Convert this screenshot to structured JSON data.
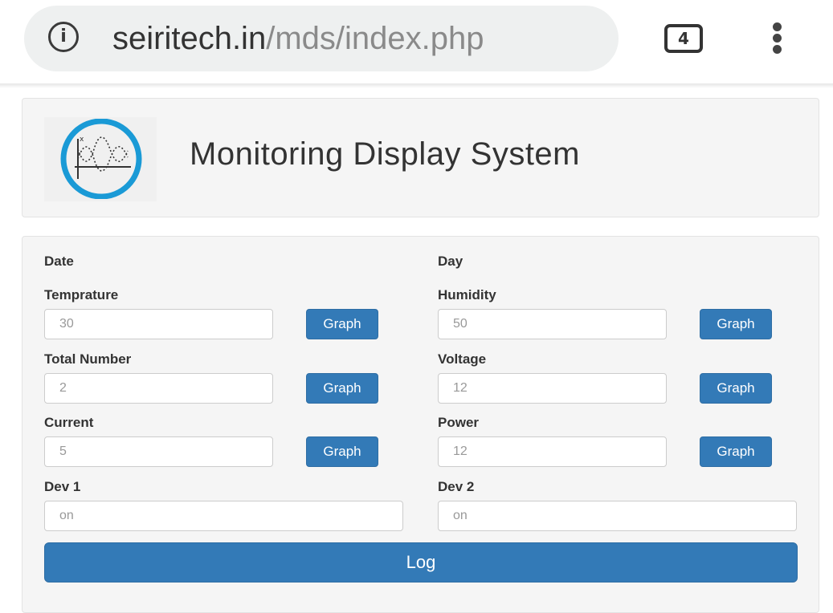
{
  "browser": {
    "url_host": "seiritech.in",
    "url_path": "/mds/index.php",
    "tab_count": "4",
    "info_icon": "info-icon",
    "menu_icon": "more-vert-icon"
  },
  "header": {
    "title": "Monitoring Display System",
    "logo_icon": "waveform-chart-icon",
    "logo_color": "#1a9ad6"
  },
  "form": {
    "date_label": "Date",
    "day_label": "Day",
    "temperature": {
      "label": "Temprature",
      "value": "30",
      "button": "Graph"
    },
    "humidity": {
      "label": "Humidity",
      "value": "50",
      "button": "Graph"
    },
    "total_number": {
      "label": "Total Number",
      "value": "2",
      "button": "Graph"
    },
    "voltage": {
      "label": "Voltage",
      "value": "12",
      "button": "Graph"
    },
    "current": {
      "label": "Current",
      "value": "5",
      "button": "Graph"
    },
    "power": {
      "label": "Power",
      "value": "12",
      "button": "Graph"
    },
    "dev1": {
      "label": "Dev 1",
      "value": "on"
    },
    "dev2": {
      "label": "Dev 2",
      "value": "on"
    },
    "log_button": "Log"
  },
  "colors": {
    "primary": "#337ab7",
    "panel_bg": "#f5f5f5"
  }
}
